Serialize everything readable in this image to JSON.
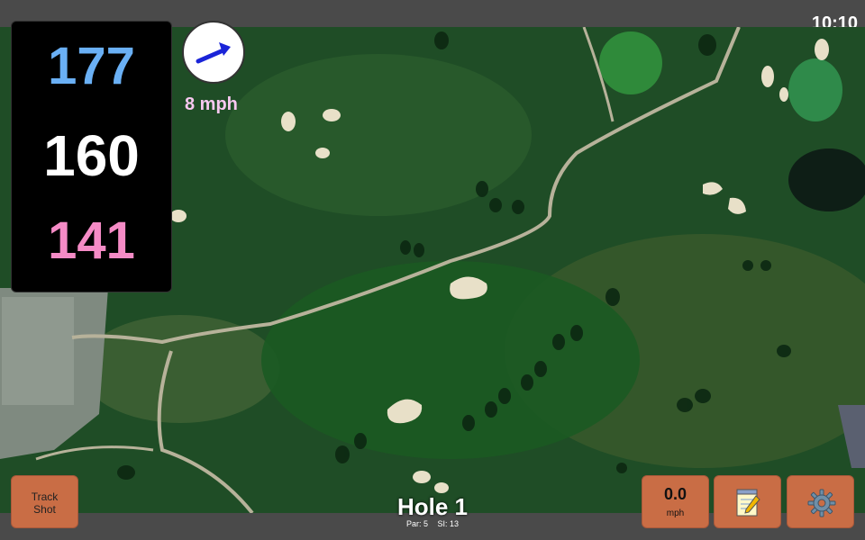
{
  "status_bar": {
    "time": "10:10"
  },
  "distances": {
    "back": "177",
    "middle": "160",
    "front": "141"
  },
  "wind": {
    "speed": "8 mph",
    "direction_icon": "arrow-right-up-icon"
  },
  "hole": {
    "title": "Hole 1",
    "par": "Par: 5",
    "stroke_index": "SI: 13"
  },
  "buttons": {
    "track_shot_line1": "Track",
    "track_shot_line2": "Shot",
    "speed_value": "0.0",
    "speed_unit": "mph",
    "notes_icon": "notepad-icon",
    "settings_icon": "gear-icon"
  },
  "colors": {
    "back_distance": "#6ab0f5",
    "middle_distance": "#ffffff",
    "front_distance": "#f58bc6",
    "wind_speed": "#f7c8f0",
    "button": "#c96d45",
    "arrow": "#1a24d8"
  }
}
